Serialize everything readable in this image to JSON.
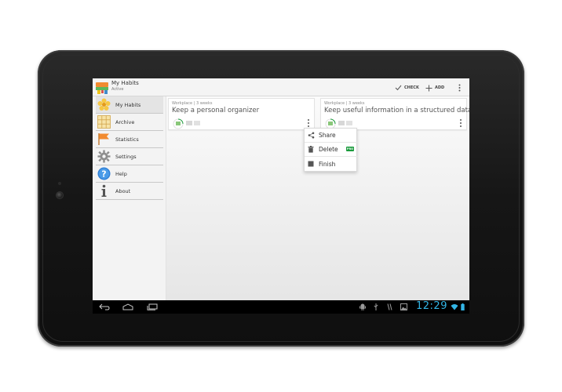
{
  "app": {
    "title": "My Habits",
    "subtitle": "Active",
    "accent": "#33b5e5",
    "brand_green": "#1a9b3c"
  },
  "actionbar": {
    "check_label": "CHECK",
    "add_label": "ADD",
    "check_icon": "checkmark-icon",
    "add_icon": "plus-icon",
    "overflow_icon": "overflow-menu-icon"
  },
  "sidebar": {
    "items": [
      {
        "label": "My Habits",
        "icon": "flower-icon",
        "active": true
      },
      {
        "label": "Archive",
        "icon": "grid-icon",
        "active": false
      },
      {
        "label": "Statistics",
        "icon": "flag-icon",
        "active": false
      },
      {
        "label": "Settings",
        "icon": "gear-icon",
        "active": false
      },
      {
        "label": "Help",
        "icon": "help-icon",
        "active": false
      },
      {
        "label": "About",
        "icon": "info-icon",
        "active": false
      }
    ]
  },
  "habits": [
    {
      "meta": "Workplace | 3 weeks",
      "title": "Keep a personal organizer"
    },
    {
      "meta": "Workplace | 3 weeks",
      "title": "Keep useful information in a structured data ..."
    }
  ],
  "popup_menu": {
    "items": [
      {
        "label": "Share",
        "icon": "share-icon"
      },
      {
        "label": "Delete",
        "icon": "trash-icon",
        "badge": "PRO"
      },
      {
        "label": "Finish",
        "icon": "stop-icon"
      }
    ]
  },
  "system": {
    "clock": "12:29",
    "nav": [
      "back-icon",
      "home-icon",
      "recents-icon"
    ],
    "status": [
      "android-debug-icon",
      "usb-icon",
      "sync-icon",
      "image-icon",
      "wifi-icon",
      "battery-icon"
    ]
  }
}
